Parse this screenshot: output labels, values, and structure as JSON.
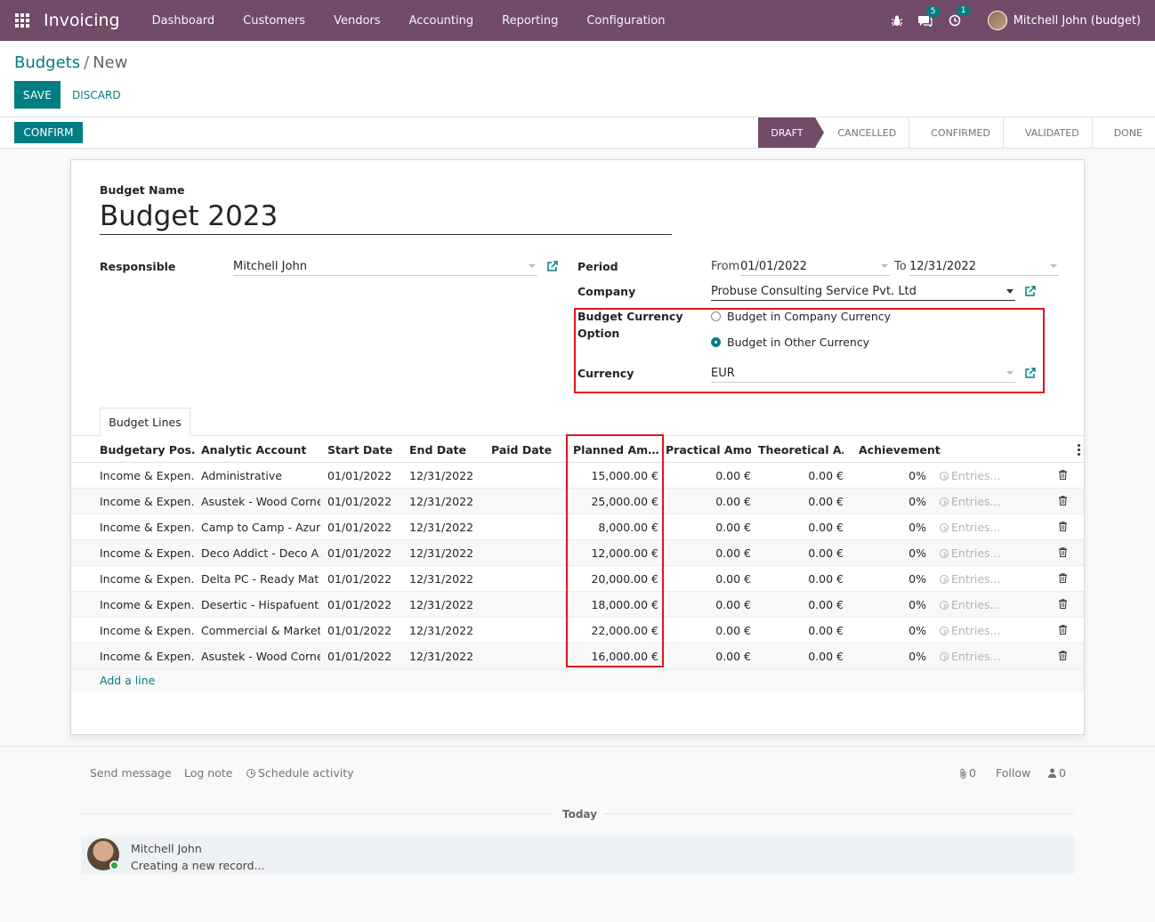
{
  "navbar": {
    "app_name": "Invoicing",
    "menu": [
      "Dashboard",
      "Customers",
      "Vendors",
      "Accounting",
      "Reporting",
      "Configuration"
    ],
    "messages_count": "5",
    "activities_count": "1",
    "user_name": "Mitchell John (budget)"
  },
  "breadcrumb": {
    "parent": "Budgets",
    "separator": "/",
    "current": "New"
  },
  "buttons": {
    "save": "SAVE",
    "discard": "DISCARD",
    "confirm": "CONFIRM"
  },
  "stages": [
    "DRAFT",
    "CANCELLED",
    "CONFIRMED",
    "VALIDATED",
    "DONE"
  ],
  "active_stage": "DRAFT",
  "form": {
    "budget_name_label": "Budget Name",
    "budget_name": "Budget 2023",
    "responsible_label": "Responsible",
    "responsible": "Mitchell John",
    "period_label": "Period",
    "from_label": "From",
    "from_date": "01/01/2022",
    "to_label": "To",
    "to_date": "12/31/2022",
    "company_label": "Company",
    "company": "Probuse Consulting Service Pvt. Ltd",
    "currency_option_label_1": "Budget Currency",
    "currency_option_label_2": "Option",
    "option_company_currency": "Budget in Company Currency",
    "option_other_currency": "Budget in Other Currency",
    "selected_option": "Budget in Other Currency",
    "currency_label": "Currency",
    "currency": "EUR"
  },
  "tab": {
    "label": "Budget Lines"
  },
  "table": {
    "headers": [
      "Budgetary Pos…",
      "Analytic Account",
      "Start Date",
      "End Date",
      "Paid Date",
      "Planned Am…",
      "Practical Amo…",
      "Theoretical A…",
      "Achievement"
    ],
    "rows": [
      {
        "position": "Income & Expen…",
        "account": "Administrative",
        "start": "01/01/2022",
        "end": "12/31/2022",
        "paid": "",
        "planned": "15,000.00 €",
        "practical": "0.00 €",
        "theoretical": "0.00 €",
        "achievement": "0%",
        "entries": "Entries..."
      },
      {
        "position": "Income & Expen…",
        "account": "Asustek - Wood Corner",
        "start": "01/01/2022",
        "end": "12/31/2022",
        "paid": "",
        "planned": "25,000.00 €",
        "practical": "0.00 €",
        "theoretical": "0.00 €",
        "achievement": "0%",
        "entries": "Entries..."
      },
      {
        "position": "Income & Expen…",
        "account": "Camp to Camp - Azur…",
        "start": "01/01/2022",
        "end": "12/31/2022",
        "paid": "",
        "planned": "8,000.00 €",
        "practical": "0.00 €",
        "theoretical": "0.00 €",
        "achievement": "0%",
        "entries": "Entries..."
      },
      {
        "position": "Income & Expen…",
        "account": "Deco Addict - Deco A…",
        "start": "01/01/2022",
        "end": "12/31/2022",
        "paid": "",
        "planned": "12,000.00 €",
        "practical": "0.00 €",
        "theoretical": "0.00 €",
        "achievement": "0%",
        "entries": "Entries..."
      },
      {
        "position": "Income & Expen…",
        "account": "Delta PC - Ready Mat",
        "start": "01/01/2022",
        "end": "12/31/2022",
        "paid": "",
        "planned": "20,000.00 €",
        "practical": "0.00 €",
        "theoretical": "0.00 €",
        "achievement": "0%",
        "entries": "Entries..."
      },
      {
        "position": "Income & Expen…",
        "account": "Desertic - Hispafuent…",
        "start": "01/01/2022",
        "end": "12/31/2022",
        "paid": "",
        "planned": "18,000.00 €",
        "practical": "0.00 €",
        "theoretical": "0.00 €",
        "achievement": "0%",
        "entries": "Entries..."
      },
      {
        "position": "Income & Expen…",
        "account": "Commercial & Market…",
        "start": "01/01/2022",
        "end": "12/31/2022",
        "paid": "",
        "planned": "22,000.00 €",
        "practical": "0.00 €",
        "theoretical": "0.00 €",
        "achievement": "0%",
        "entries": "Entries..."
      },
      {
        "position": "Income & Expen…",
        "account": "Asustek - Wood Corner",
        "start": "01/01/2022",
        "end": "12/31/2022",
        "paid": "",
        "planned": "16,000.00 €",
        "practical": "0.00 €",
        "theoretical": "0.00 €",
        "achievement": "0%",
        "entries": "Entries..."
      }
    ],
    "add_line": "Add a line"
  },
  "chatter": {
    "send_message": "Send message",
    "log_note": "Log note",
    "schedule_activity": "Schedule activity",
    "attachments_count": "0",
    "follow": "Follow",
    "followers_count": "0",
    "today": "Today",
    "author": "Mitchell John",
    "body": "Creating a new record..."
  },
  "colors": {
    "brand": "#714b67",
    "accent": "#017e84",
    "highlight": "#e0131f"
  },
  "icons": [
    "apps-grid-icon",
    "bug-icon",
    "chat-icon",
    "clock-icon",
    "external-link-icon",
    "trash-icon",
    "paperclip-icon",
    "user-icon",
    "arrow-circle-icon"
  ]
}
